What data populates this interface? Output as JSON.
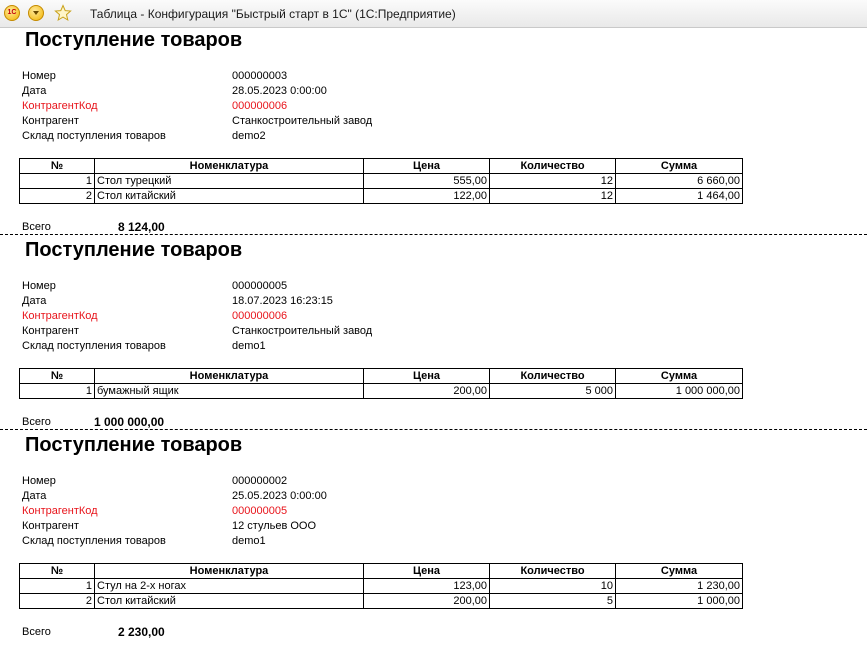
{
  "window": {
    "title": "Таблица - Конфигурация \"Быстрый старт в 1С\"  (1С:Предприятие)",
    "app_logo": "1С"
  },
  "labels": {
    "number": "Номер",
    "date": "Дата",
    "contractor_code": "КонтрагентКод",
    "contractor": "Контрагент",
    "warehouse": "Склад поступления товаров",
    "total": "Всего"
  },
  "columns": [
    "№",
    "Номенклатура",
    "Цена",
    "Количество",
    "Сумма"
  ],
  "documents": [
    {
      "title": "Поступление товаров",
      "number": "000000003",
      "date": "28.05.2023 0:00:00",
      "contractor_code": "000000006",
      "contractor": "Станкостроительный завод",
      "warehouse": "demo2",
      "rows": [
        {
          "n": "1",
          "item": "Стол турецкий",
          "price": "555,00",
          "qty": "12",
          "sum": "6 660,00"
        },
        {
          "n": "2",
          "item": "Стол китайский",
          "price": "122,00",
          "qty": "12",
          "sum": "1 464,00"
        }
      ],
      "total": "8 124,00"
    },
    {
      "title": "Поступление товаров",
      "number": "000000005",
      "date": "18.07.2023 16:23:15",
      "contractor_code": "000000006",
      "contractor": "Станкостроительный завод",
      "warehouse": "demo1",
      "rows": [
        {
          "n": "1",
          "item": "бумажный ящик",
          "price": "200,00",
          "qty": "5 000",
          "sum": "1 000 000,00"
        }
      ],
      "total": "1 000 000,00"
    },
    {
      "title": "Поступление товаров",
      "number": "000000002",
      "date": "25.05.2023 0:00:00",
      "contractor_code": "000000005",
      "contractor": "12 стульев ООО",
      "warehouse": "demo1",
      "rows": [
        {
          "n": "1",
          "item": "Стул на 2-х ногах",
          "price": "123,00",
          "qty": "10",
          "sum": "1 230,00"
        },
        {
          "n": "2",
          "item": "Стол китайский",
          "price": "200,00",
          "qty": "5",
          "sum": "1 000,00"
        }
      ],
      "total": "2 230,00"
    }
  ],
  "colors": {
    "contractor_code": "#e8141b"
  },
  "icons": [
    "app-1c-icon",
    "main-menu-icon",
    "favorites-star-icon"
  ]
}
